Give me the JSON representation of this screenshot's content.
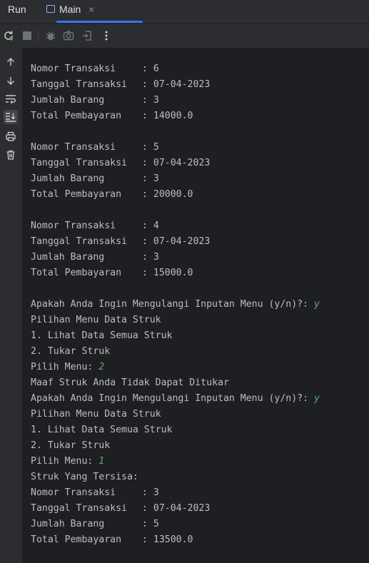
{
  "tabs": {
    "run_label": "Run",
    "main_label": "Main",
    "close_glyph": "×"
  },
  "toolbar": {
    "icons": [
      "rerun-icon",
      "stop-icon",
      "debug-icon",
      "camera-icon",
      "exit-icon",
      "more-icon"
    ]
  },
  "sidebar": {
    "icons": [
      "arrow-up-icon",
      "arrow-down-icon",
      "soft-wrap-icon",
      "scroll-to-end-icon",
      "print-icon",
      "trash-icon"
    ]
  },
  "colors": {
    "background": "#1e1f22",
    "panel": "#2b2d30",
    "text": "#bcbec4",
    "user_input": "#57ab5a",
    "accent": "#3574f0"
  },
  "console": {
    "records": [
      {
        "fields": [
          {
            "label": "Nomor Transaksi",
            "sep": ": ",
            "value": "6"
          },
          {
            "label": "Tanggal Transaksi",
            "sep": ": ",
            "value": "07-04-2023"
          },
          {
            "label": "Jumlah Barang",
            "sep": ": ",
            "value": "3"
          },
          {
            "label": "Total Pembayaran",
            "sep": ": ",
            "value": "14000.0"
          }
        ]
      },
      {
        "fields": [
          {
            "label": "Nomor Transaksi",
            "sep": ": ",
            "value": "5"
          },
          {
            "label": "Tanggal Transaksi",
            "sep": ": ",
            "value": "07-04-2023"
          },
          {
            "label": "Jumlah Barang",
            "sep": ": ",
            "value": "3"
          },
          {
            "label": "Total Pembayaran",
            "sep": ": ",
            "value": "20000.0"
          }
        ]
      },
      {
        "fields": [
          {
            "label": "Nomor Transaksi",
            "sep": ": ",
            "value": "4"
          },
          {
            "label": "Tanggal Transaksi",
            "sep": ": ",
            "value": "07-04-2023"
          },
          {
            "label": "Jumlah Barang",
            "sep": ": ",
            "value": "3"
          },
          {
            "label": "Total Pembayaran",
            "sep": ": ",
            "value": "15000.0"
          }
        ]
      }
    ],
    "session": [
      {
        "text": "Apakah Anda Ingin Mengulangi Inputan Menu (y/n)?: ",
        "input": "y"
      },
      {
        "text": "Pilihan Menu Data Struk"
      },
      {
        "text": "1. Lihat Data Semua Struk"
      },
      {
        "text": "2. Tukar Struk"
      },
      {
        "text": "Pilih Menu: ",
        "input": "2"
      },
      {
        "text": "Maaf Struk Anda Tidak Dapat Ditukar"
      },
      {
        "text": "Apakah Anda Ingin Mengulangi Inputan Menu (y/n)?: ",
        "input": "y"
      },
      {
        "text": "Pilihan Menu Data Struk"
      },
      {
        "text": "1. Lihat Data Semua Struk"
      },
      {
        "text": "2. Tukar Struk"
      },
      {
        "text": "Pilih Menu: ",
        "input": "1"
      },
      {
        "text": "Struk Yang Tersisa:"
      }
    ],
    "final_record": {
      "fields": [
        {
          "label": "Nomor Transaksi",
          "sep": ": ",
          "value": "3"
        },
        {
          "label": "Tanggal Transaksi",
          "sep": ": ",
          "value": "07-04-2023"
        },
        {
          "label": "Jumlah Barang",
          "sep": ": ",
          "value": "5"
        },
        {
          "label": "Total Pembayaran",
          "sep": ": ",
          "value": "13500.0"
        }
      ]
    }
  }
}
